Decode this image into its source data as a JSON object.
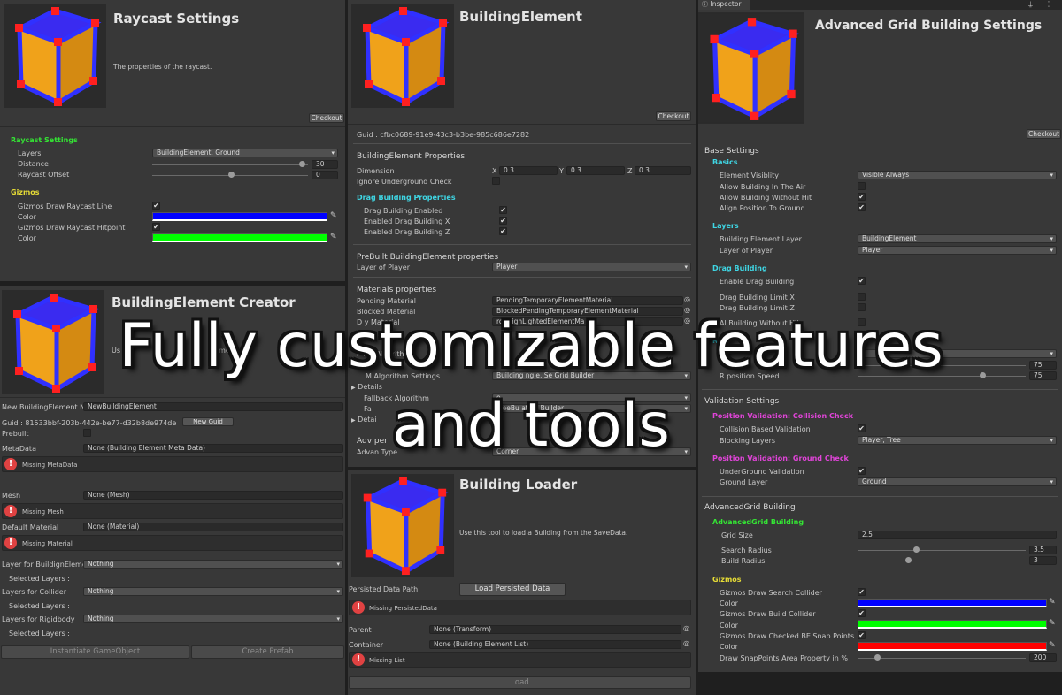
{
  "left": {
    "raycast": {
      "title": "Raycast Settings",
      "description": "The properties of the raycast.",
      "checkout": "Checkout",
      "section_raycast": "Raycast Settings",
      "layers_label": "Layers",
      "layers_value": "BuildingElement, Ground",
      "distance_label": "Distance",
      "distance_value": "30",
      "offset_label": "Raycast Offset",
      "offset_value": "0",
      "section_gizmos": "Gizmos",
      "draw_line_label": "Gizmos Draw Raycast Line",
      "color_label": "Color",
      "draw_hitpoint_label": "Gizmos Draw Raycast Hitpoint",
      "color2_label": "Color",
      "line_color": "#0000ff",
      "hit_color": "#00ff00"
    },
    "creator": {
      "title": "BuildingElement Creator",
      "partial_text": "Us",
      "partial_text2": "lement",
      "name_label": "New BuildingElement Nam",
      "name_value": "NewBuildingElement",
      "guid_text": "Guid : 81533bbf-203b-442e-be77-d32b8de974de",
      "new_guid": "New Guid",
      "prebuilt_label": "Prebuilt",
      "metadata_label": "MetaData",
      "metadata_value": "None (Building Element Meta Data)",
      "missing_metadata": "Missing MetaData",
      "mesh_label": "Mesh",
      "mesh_value": "None (Mesh)",
      "missing_mesh": "Missing Mesh",
      "material_label": "Default Material",
      "material_value": "None (Material)",
      "missing_material": "Missing Material",
      "layer_be_label": "Layer for BuildignElement",
      "layer_be_value": "Nothing",
      "selected_layers1": "Selected Layers :",
      "layers_collider_label": "Layers for Collider",
      "layers_collider_value": "Nothing",
      "selected_layers2": "Selected Layers :",
      "layers_rb_label": "Layers for Rigidbody",
      "layers_rb_value": "Nothing",
      "selected_layers3": "Selected Layers :",
      "instantiate": "Instantiate GameObject",
      "create_prefab": "Create Prefab"
    }
  },
  "middle": {
    "be": {
      "title": "BuildingElement",
      "checkout": "Checkout",
      "guid": "Guid : cfbc0689-91e9-43c3-b3be-985c686e7282",
      "props_title": "BuildingElement Properties",
      "dimension_label": "Dimension",
      "x_label": "X",
      "x_value": "0.3",
      "y_label": "Y",
      "y_value": "0.3",
      "z_label": "Z",
      "z_value": "0.3",
      "ignore_label": "Ignore Underground Check",
      "drag_title": "Drag Building Properties",
      "drag_enabled": "Drag Building Enabled",
      "drag_x": "Enabled Drag Building X",
      "drag_z": "Enabled Drag Building Z",
      "prebuilt_title": "PreBuilt BuildingElement properties",
      "layer_player_label": "Layer of Player",
      "layer_player_value": "Player",
      "materials_title": "Materials properties",
      "pending_label": "Pending Material",
      "pending_value": "PendingTemporaryElementMaterial",
      "blocked_label": "Blocked Material",
      "blocked_value": "BlockedPendingTemporaryElementMaterial",
      "destroy_label": "D   y Material",
      "destroy_value": "   royHighLightedElementMa",
      "partial_m": "M",
      "partial_algo": "P        ion Algorithm",
      "partial_algo2": "M   Algorithm Settings",
      "partial_algo_val": "e",
      "partial_algo_val2": "Building   ngle, Se     Grid   Builder",
      "details": "Details",
      "fallback_label": "Fallback Algorithm",
      "fallback_value": "e",
      "fa_label": "Fa",
      "fa_value": "FreeBu           ation   Builder",
      "details2": "Detai",
      "adv_label": "Adv                per",
      "adv_type_label": "Advan          Type",
      "adv_type_value": "Corner"
    },
    "loader": {
      "title": "Building Loader",
      "description": "Use this tool to load a Building from the SaveData.",
      "path_label": "Persisted Data Path",
      "load_persisted": "Load Persisted Data",
      "missing_persisted": "Missing PersistedData",
      "parent_label": "Parent",
      "parent_value": "None (Transform)",
      "container_label": "Container",
      "container_value": "None (Building Element List)",
      "missing_list": "Missing List",
      "load": "Load"
    }
  },
  "right": {
    "tab": "Inspector",
    "title": "Advanced Grid Building Settings",
    "checkout": "Checkout",
    "base_settings": "Base Settings",
    "basics": "Basics",
    "visibility_label": "Element Visiblity",
    "visibility_value": "Visible Always",
    "allow_air": "Allow Building In The Air",
    "allow_nohit": "Allow Building Without Hit",
    "align_ground": "Align Position To Ground",
    "layers": "Layers",
    "be_layer_label": "Building Element Layer",
    "be_layer_value": "BuildingElement",
    "player_layer_label": "Layer of Player",
    "player_layer_value": "Player",
    "drag": "Drag Building",
    "enable_drag": "Enable Drag Building",
    "drag_limit_x": "Drag Building Limit X",
    "drag_limit_z": "Drag Building Limit Z",
    "drag_nohit": "Al          Building Without Hit",
    "rep_partial": "Re",
    "rep_label1": "Bu",
    "rep_value1": "75",
    "rep_value2": "75",
    "rep_label3": "R   position        Speed",
    "validation": "Validation Settings",
    "collision_check": "Position Validation: Collision Check",
    "collision_validation": "Collision Based Validation",
    "blocking_layers_label": "Blocking Layers",
    "blocking_layers_value": "Player, Tree",
    "ground_check": "Position Validation: Ground Check",
    "underground": "UnderGround Validation",
    "ground_layer_label": "Ground Layer",
    "ground_layer_value": "Ground",
    "adv_grid": "AdvancedGrid Building",
    "adv_grid_green": "AdvancedGrid Building",
    "grid_size_label": "Grid Size",
    "grid_size_value": "2.5",
    "search_radius_label": "Search Radius",
    "search_radius_value": "3.5",
    "build_radius_label": "Build Radius",
    "build_radius_value": "3",
    "gizmos": "Gizmos",
    "draw_search": "Gizmos Draw Search Collider",
    "color1": "Color",
    "draw_build": "Gizmos Draw Build Collider",
    "color2": "Color",
    "draw_snap": "Gizmos Draw Checked BE Snap Points",
    "color3": "Color",
    "snap_area_label": "Draw SnapPoints Area Property in %",
    "snap_area_value": "200",
    "c_blue": "#0000ff",
    "c_green": "#00ff00",
    "c_red": "#ff0000"
  },
  "overlay": {
    "line1": "Fully customizable features",
    "line2": "and tools"
  },
  "icons": {
    "check": "✔",
    "arrow": "▾",
    "picker": "✎",
    "target": "◎",
    "error": "!",
    "foldout": "▶",
    "lock": "🔒",
    "menu": "⋮"
  }
}
